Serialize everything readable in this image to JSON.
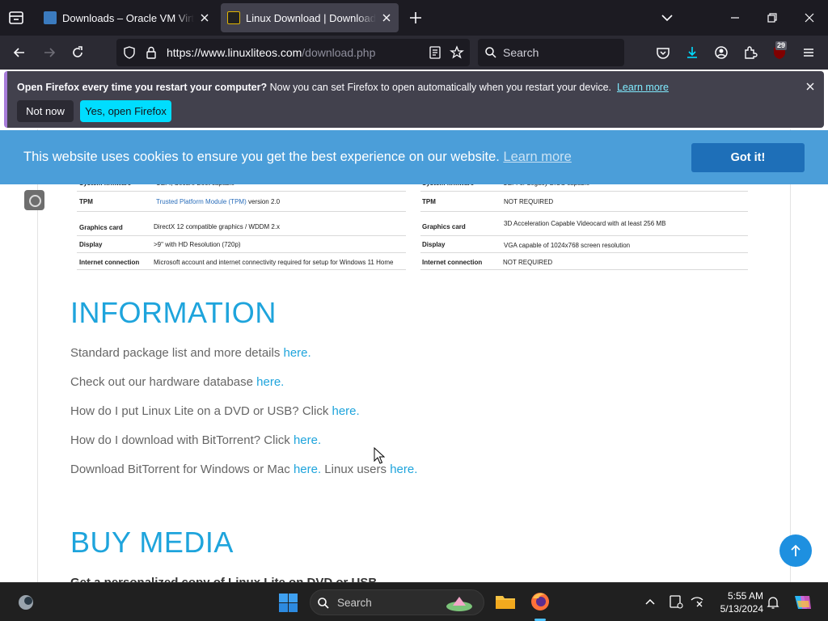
{
  "browser": {
    "tabs": [
      {
        "title": "Downloads – Oracle VM VirtualBox",
        "active": false
      },
      {
        "title": "Linux Download | Download Linux Lite",
        "active": true
      }
    ],
    "url_host": "https://www.linuxliteos.com",
    "url_path": "/download.php",
    "search_placeholder": "Search",
    "ublock_count": "29"
  },
  "notification": {
    "bold_text": "Open Firefox every time you restart your computer?",
    "text": " Now you can set Firefox to open automatically when you restart your device.",
    "learn_more": "Learn more",
    "not_now_label": "Not now",
    "yes_label": "Yes, open Firefox"
  },
  "cookie_banner": {
    "text": "This website uses cookies to ensure you get the best experience on our website.",
    "learn_more": "Learn more",
    "button_label": "Got it!"
  },
  "requirements": {
    "left": [
      {
        "key": "System firmware",
        "value": "UEFI, Secure Boot capable"
      },
      {
        "key": "TPM",
        "value": "Trusted Platform Module (TPM)",
        "value_suffix": " version 2.0"
      },
      {
        "key": "Graphics card",
        "value": "DirectX 12 compatible graphics / WDDM 2.x"
      },
      {
        "key": "Display",
        "value": ">9\" with HD Resolution (720p)"
      },
      {
        "key": "Internet connection",
        "value": "Microsoft account and internet connectivity required for setup for Windows 11 Home"
      }
    ],
    "right": [
      {
        "key": "System firmware",
        "value": "UEFI or Legacy BIOS capable"
      },
      {
        "key": "TPM",
        "value": "NOT REQUIRED"
      },
      {
        "key": "Graphics card",
        "value": "3D Acceleration Capable Videocard with at least 256 MB"
      },
      {
        "key": "Display",
        "value": "VGA capable of 1024x768 screen resolution"
      },
      {
        "key": "Internet connection",
        "value": "NOT REQUIRED"
      }
    ]
  },
  "information": {
    "heading": "INFORMATION",
    "lines": [
      {
        "text": "Standard package list and more details ",
        "link": "here."
      },
      {
        "text": "Check out our hardware database ",
        "link": "here."
      },
      {
        "text": "How do I put Linux Lite on a DVD or USB? Click ",
        "link": "here."
      },
      {
        "text": "How do I download with BitTorrent? Click ",
        "link": "here."
      },
      {
        "text": "Download BitTorrent for Windows or Mac ",
        "link": "here.",
        "text2": " Linux users ",
        "link2": "here."
      }
    ]
  },
  "buy_media": {
    "heading": "BUY MEDIA",
    "subline": "Get a personalized copy of Linux Lite on DVD or USB"
  },
  "taskbar": {
    "search_placeholder": "Search",
    "time": "5:55 AM",
    "date": "5/13/2024"
  },
  "colors": {
    "accent": "#1ea4dc",
    "cookie_bg": "#4b9ed9",
    "firefox_cyan": "#00ddff"
  }
}
